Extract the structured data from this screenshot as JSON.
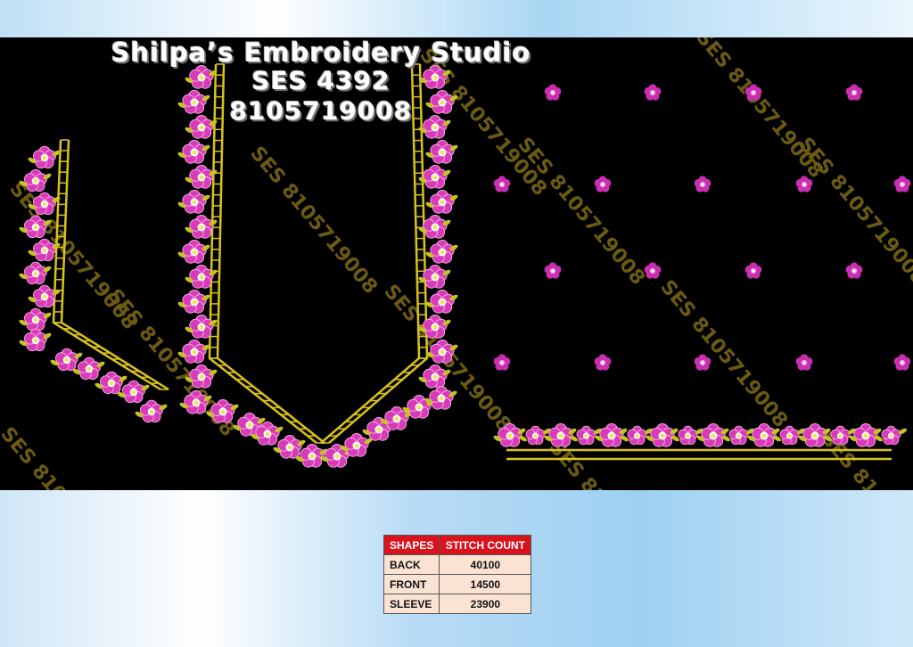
{
  "studio": {
    "title": "Shilpa’s Embroidery Studio",
    "code": "SES  4392",
    "phone": "8105719008"
  },
  "watermark": "SES 8105719008",
  "colors": {
    "background": "#000000",
    "flower_petal": "#d83ab8",
    "flower_center": "#fbf0a0",
    "border_gold": "#d8c21c",
    "leaf": "#c6c222",
    "watermark": "#6b5a12"
  },
  "table": {
    "headers": [
      "SHAPES",
      "STITCH COUNT"
    ],
    "rows": [
      {
        "shape": "BACK",
        "count": "40100"
      },
      {
        "shape": "FRONT",
        "count": "14500"
      },
      {
        "shape": "SLEEVE",
        "count": "23900"
      }
    ]
  }
}
